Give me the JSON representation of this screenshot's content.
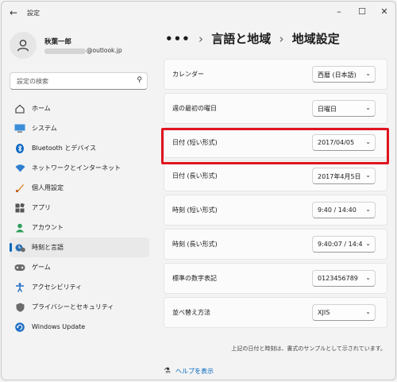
{
  "window": {
    "title": "設定"
  },
  "user": {
    "name": "秋葉一郎",
    "email_suffix": "@outlook.jp"
  },
  "search": {
    "placeholder": "設定の検索"
  },
  "nav": [
    {
      "label": "ホーム",
      "icon": "home-icon",
      "active": false
    },
    {
      "label": "システム",
      "icon": "system-icon",
      "active": false
    },
    {
      "label": "Bluetooth とデバイス",
      "icon": "bluetooth-icon",
      "active": false
    },
    {
      "label": "ネットワークとインターネット",
      "icon": "network-icon",
      "active": false
    },
    {
      "label": "個人用設定",
      "icon": "personalization-icon",
      "active": false
    },
    {
      "label": "アプリ",
      "icon": "apps-icon",
      "active": false
    },
    {
      "label": "アカウント",
      "icon": "accounts-icon",
      "active": false
    },
    {
      "label": "時刻と言語",
      "icon": "time-language-icon",
      "active": true
    },
    {
      "label": "ゲーム",
      "icon": "gaming-icon",
      "active": false
    },
    {
      "label": "アクセシビリティ",
      "icon": "accessibility-icon",
      "active": false
    },
    {
      "label": "プライバシーとセキュリティ",
      "icon": "privacy-icon",
      "active": false
    },
    {
      "label": "Windows Update",
      "icon": "windows-update-icon",
      "active": false
    }
  ],
  "breadcrumb": {
    "ellipsis": "•••",
    "parent": "言語と地域",
    "current": "地域設定"
  },
  "settings": [
    {
      "label": "カレンダー",
      "value": "西暦 (日本語)"
    },
    {
      "label": "週の最初の曜日",
      "value": "日曜日"
    },
    {
      "label": "日付 (短い形式)",
      "value": "2017/04/05"
    },
    {
      "label": "日付 (長い形式)",
      "value": "2017年4月5日"
    },
    {
      "label": "時刻 (短い形式)",
      "value": "9:40 / 14:40"
    },
    {
      "label": "時刻 (長い形式)",
      "value": "9:40:07 / 14:4"
    },
    {
      "label": "標準の数字表記",
      "value": "0123456789"
    },
    {
      "label": "並べ替え方法",
      "value": "XJIS"
    }
  ],
  "note": "上記の日付と時刻は、書式のサンプルとして示されています。",
  "help": {
    "label": "ヘルプを表示"
  },
  "colors": {
    "accent": "#0067c0",
    "highlight": "#e0141e"
  }
}
